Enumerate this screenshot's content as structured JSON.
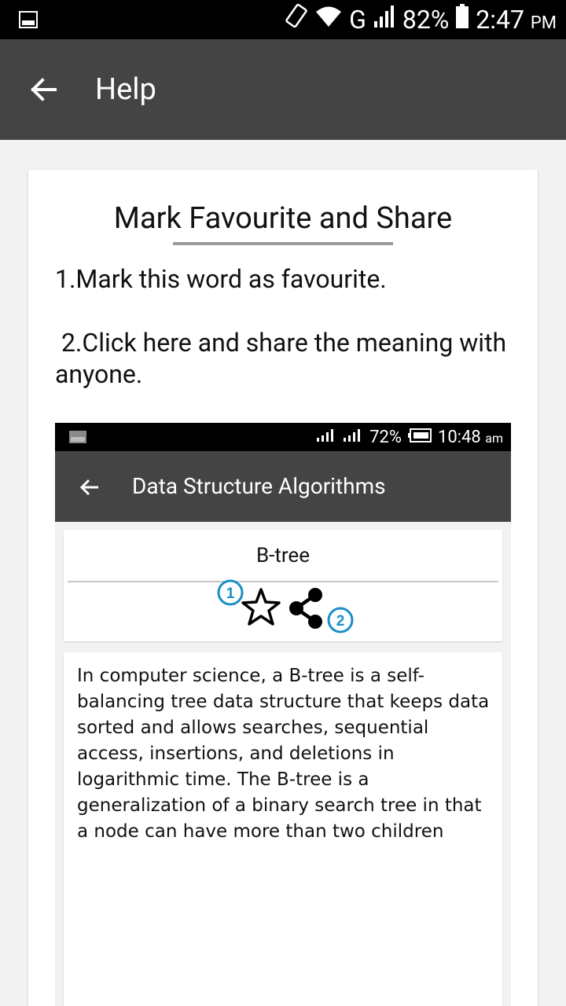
{
  "status_bar": {
    "battery": "82%",
    "network": "G",
    "time": "2:47",
    "ampm": "PM"
  },
  "toolbar": {
    "title": "Help"
  },
  "help": {
    "title": "Mark Favourite and Share",
    "step1": "1.Mark this word as favourite.",
    "step2": " 2.Click here and share the meaning with anyone."
  },
  "screenshot": {
    "status_bar": {
      "battery": "72%",
      "time": "10:48",
      "ampm": "am"
    },
    "toolbar_title": "Data Structure Algorithms",
    "word": "B-tree",
    "badge1": "1",
    "badge2": "2",
    "description": "In computer science, a B-tree is a self-balancing tree data structure that keeps data sorted and allows searches, sequential access, insertions, and deletions in logarithmic time. The B-tree is a generalization of a binary search tree in that a node can have more than two children"
  },
  "colors": {
    "toolbar": "#444444",
    "badge": "#1a8fc4"
  }
}
